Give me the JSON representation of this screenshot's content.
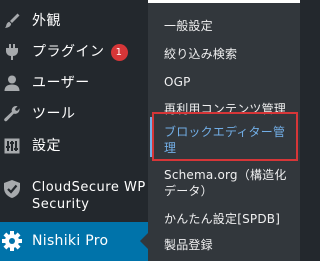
{
  "sidebar": {
    "items": [
      {
        "name": "appearance",
        "label": "外観",
        "icon": "paintbrush-icon"
      },
      {
        "name": "plugins",
        "label": "プラグイン",
        "icon": "plugin-icon",
        "badge": "1"
      },
      {
        "name": "users",
        "label": "ユーザー",
        "icon": "user-icon"
      },
      {
        "name": "tools",
        "label": "ツール",
        "icon": "wrench-icon"
      },
      {
        "name": "settings",
        "label": "設定",
        "icon": "settings-icon"
      },
      {
        "name": "cloudsecure",
        "label": "CloudSecure WP Security",
        "icon": "shield-check-icon"
      }
    ],
    "active": {
      "label": "Nishiki Pro",
      "icon": "gear-icon"
    }
  },
  "submenu": {
    "items": [
      {
        "label": "一般設定"
      },
      {
        "label": "絞り込み検索"
      },
      {
        "label": "OGP"
      },
      {
        "label": "再利用コンテンツ管理"
      },
      {
        "label": "ブロックエディター管理"
      },
      {
        "label": "Schema.org（構造化データ）"
      },
      {
        "label": "かんたん設定[SPDB]"
      },
      {
        "label": "製品登録"
      }
    ]
  },
  "colors": {
    "sidebar_bg": "#23282d",
    "submenu_bg": "#32373c",
    "active_bg": "#0073aa",
    "badge_bg": "#d63638",
    "highlight_border": "#d63638",
    "current_text": "#72aee6"
  }
}
